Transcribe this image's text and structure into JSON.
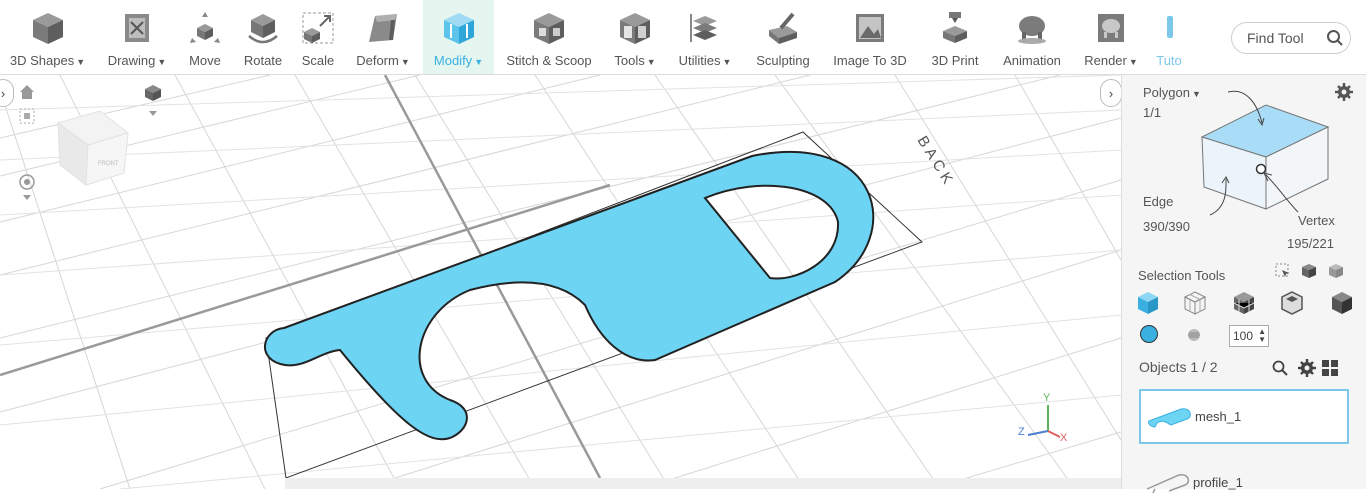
{
  "toolbar": {
    "tools": [
      {
        "label": "3D Shapes",
        "dropdown": true,
        "icon": "cube-icon"
      },
      {
        "label": "Drawing",
        "dropdown": true,
        "icon": "drawing-icon"
      },
      {
        "label": "Move",
        "dropdown": false,
        "icon": "move-icon"
      },
      {
        "label": "Rotate",
        "dropdown": false,
        "icon": "rotate-icon"
      },
      {
        "label": "Scale",
        "dropdown": false,
        "icon": "scale-icon"
      },
      {
        "label": "Deform",
        "dropdown": true,
        "icon": "deform-icon"
      },
      {
        "label": "Modify",
        "dropdown": true,
        "icon": "modify-icon",
        "active": true
      },
      {
        "label": "Stitch & Scoop",
        "dropdown": false,
        "icon": "stitch-scoop-icon"
      },
      {
        "label": "Tools",
        "dropdown": true,
        "icon": "tools-icon"
      },
      {
        "label": "Utilities",
        "dropdown": true,
        "icon": "utilities-icon"
      },
      {
        "label": "Sculpting",
        "dropdown": false,
        "icon": "sculpting-icon"
      },
      {
        "label": "Image To 3D",
        "dropdown": false,
        "icon": "image-to-3d-icon"
      },
      {
        "label": "3D Print",
        "dropdown": false,
        "icon": "3d-print-icon"
      },
      {
        "label": "Animation",
        "dropdown": false,
        "icon": "animation-icon"
      },
      {
        "label": "Render",
        "dropdown": true,
        "icon": "render-icon"
      },
      {
        "label": "Tuto",
        "dropdown": false,
        "icon": "tutorial-icon"
      }
    ],
    "find_tool_placeholder": "Find Tool"
  },
  "viewport": {
    "back_label": "BACK",
    "view_cube_label": "FRONT",
    "axis_labels": {
      "x": "X",
      "y": "Y",
      "z": "Z"
    }
  },
  "sidebar": {
    "selection_mode": "Polygon",
    "polygon_count": "1/1",
    "edge_label": "Edge",
    "edge_count": "390/390",
    "vertex_label": "Vertex",
    "vertex_count": "195/221",
    "selection_tools_label": "Selection Tools",
    "brush_size": "100",
    "objects_label": "Objects 1 / 2",
    "objects": [
      {
        "name": "mesh_1",
        "selected": true
      },
      {
        "name": "profile_1",
        "selected": false
      }
    ],
    "colors": {
      "accent": "#3ab0e0",
      "selected_border": "#7cc8ea",
      "mesh_fill": "#6dd4f4"
    }
  }
}
